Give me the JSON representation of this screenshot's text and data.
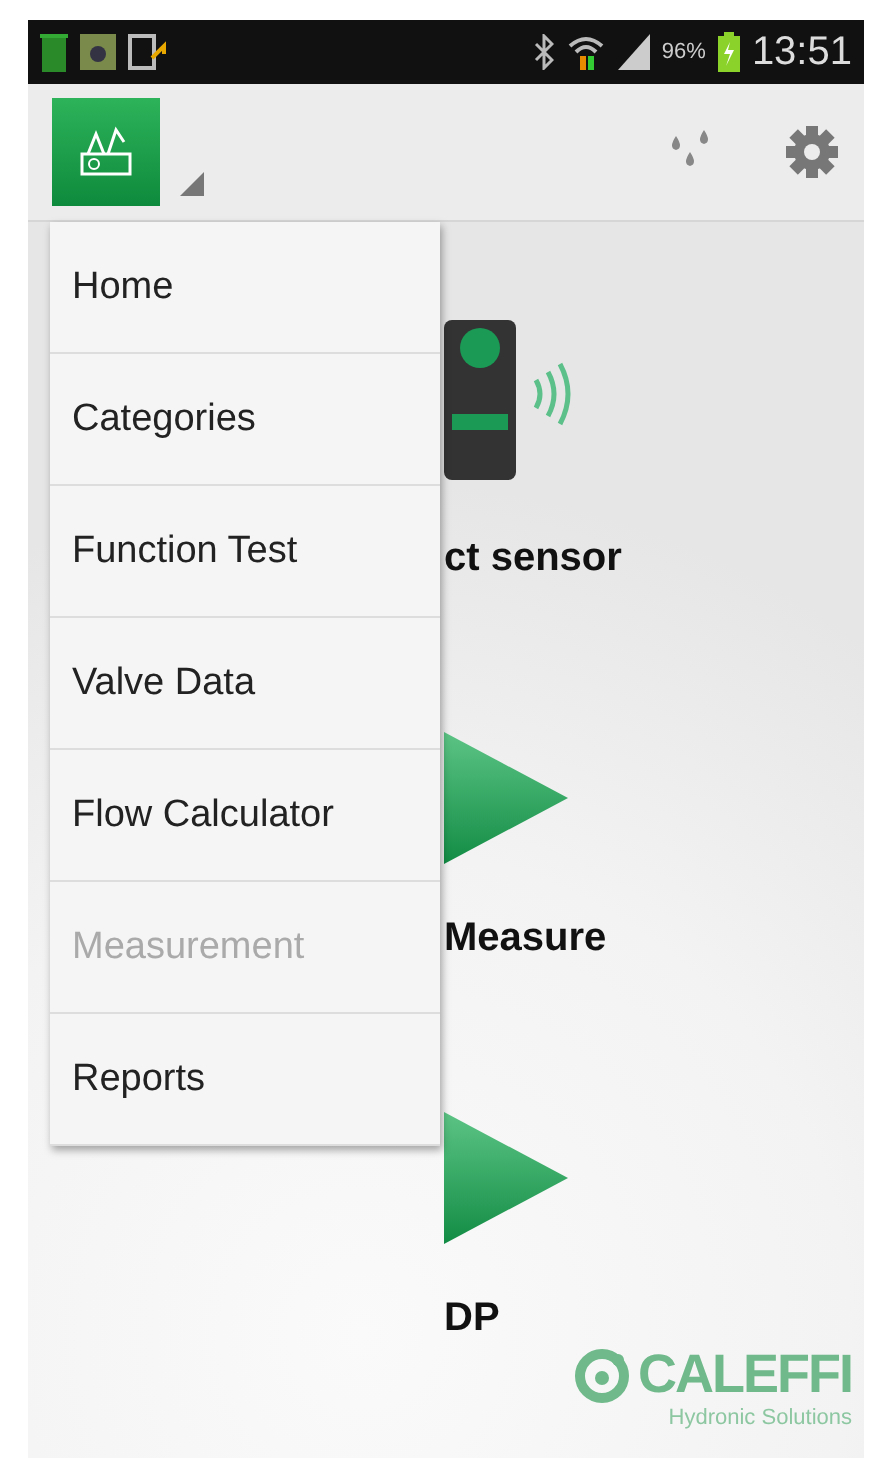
{
  "status_bar": {
    "battery_percent": "96%",
    "time": "13:51"
  },
  "menu": {
    "items": [
      {
        "label": "Home",
        "disabled": false
      },
      {
        "label": "Categories",
        "disabled": false
      },
      {
        "label": "Function Test",
        "disabled": false
      },
      {
        "label": "Valve Data",
        "disabled": false
      },
      {
        "label": "Flow Calculator",
        "disabled": false
      },
      {
        "label": "Measurement",
        "disabled": true
      },
      {
        "label": "Reports",
        "disabled": false
      }
    ]
  },
  "content": {
    "items": [
      {
        "kind": "sensor",
        "label": "ct sensor"
      },
      {
        "kind": "play",
        "label": "Measure"
      },
      {
        "kind": "play",
        "label": "DP"
      }
    ]
  },
  "logo": {
    "brand": "CALEFFI",
    "tagline": "Hydronic Solutions"
  }
}
